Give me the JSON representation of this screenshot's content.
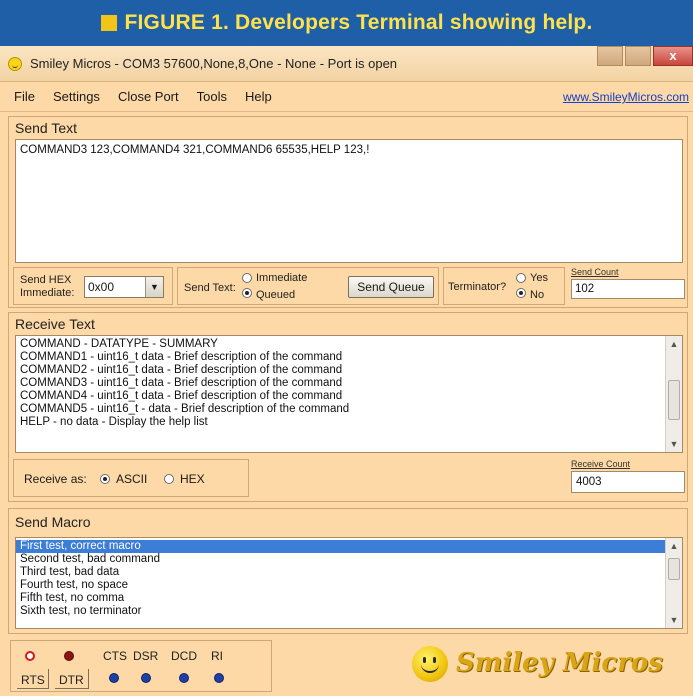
{
  "banner": {
    "caption": "FIGURE 1. Developers Terminal showing help."
  },
  "window": {
    "title": "Smiley Micros - COM3 57600,None,8,One - None - Port is open",
    "close_glyph": "x"
  },
  "menu": {
    "items": [
      "File",
      "Settings",
      "Close Port",
      "Tools",
      "Help"
    ],
    "link": "www.SmileyMicros.com"
  },
  "send_text": {
    "title": "Send Text",
    "content": "COMMAND3 123,COMMAND4 321,COMMAND6 65535,HELP 123,!",
    "send_hex_label_1": "Send HEX",
    "send_hex_label_2": "Immediate:",
    "send_hex_value": "0x00",
    "send_text_label": "Send Text:",
    "immediate_label": "Immediate",
    "queued_label": "Queued",
    "send_mode": "Queued",
    "send_queue_button": "Send Queue",
    "terminator_label": "Terminator?",
    "yes_label": "Yes",
    "no_label": "No",
    "terminator": "No",
    "send_count_label": "Send Count",
    "send_count_value": "102"
  },
  "receive_text": {
    "title": "Receive Text",
    "lines": [
      "COMMAND - DATATYPE - SUMMARY",
      "COMMAND1 - uint16_t data - Brief description of the command",
      "COMMAND2 - uint16_t data - Brief description of the command",
      "COMMAND3 - uint16_t data - Brief description of the command",
      "COMMAND4 - uint16_t data - Brief description of the command",
      "COMMAND5 - uint16_t - data - Brief description of the command",
      "HELP - no data - Display the help list"
    ],
    "receive_as_label": "Receive as:",
    "ascii_label": "ASCII",
    "hex_label": "HEX",
    "receive_as": "ASCII",
    "receive_count_label": "Receive Count",
    "receive_count_value": "4003"
  },
  "send_macro": {
    "title": "Send Macro",
    "items": [
      "First test, correct macro",
      "Second test, bad command",
      "Third test, bad data",
      "Fourth test, no space",
      "Fifth test, no comma",
      "Sixth test, no terminator"
    ],
    "selected_index": 0
  },
  "status": {
    "rts": "RTS",
    "dtr": "DTR",
    "cts": "CTS",
    "dsr": "DSR",
    "dcd": "DCD",
    "ri": "RI"
  },
  "logo": {
    "text": "Smiley Micros"
  },
  "colors": {
    "banner_bg": "#1f5fa8",
    "banner_text": "#ffe24a",
    "window_bg": "#fcd9a6",
    "link": "#1640c8",
    "selection": "#3c7dd8",
    "led_red": "#d11a1a",
    "led_blue": "#1d3fa6"
  }
}
